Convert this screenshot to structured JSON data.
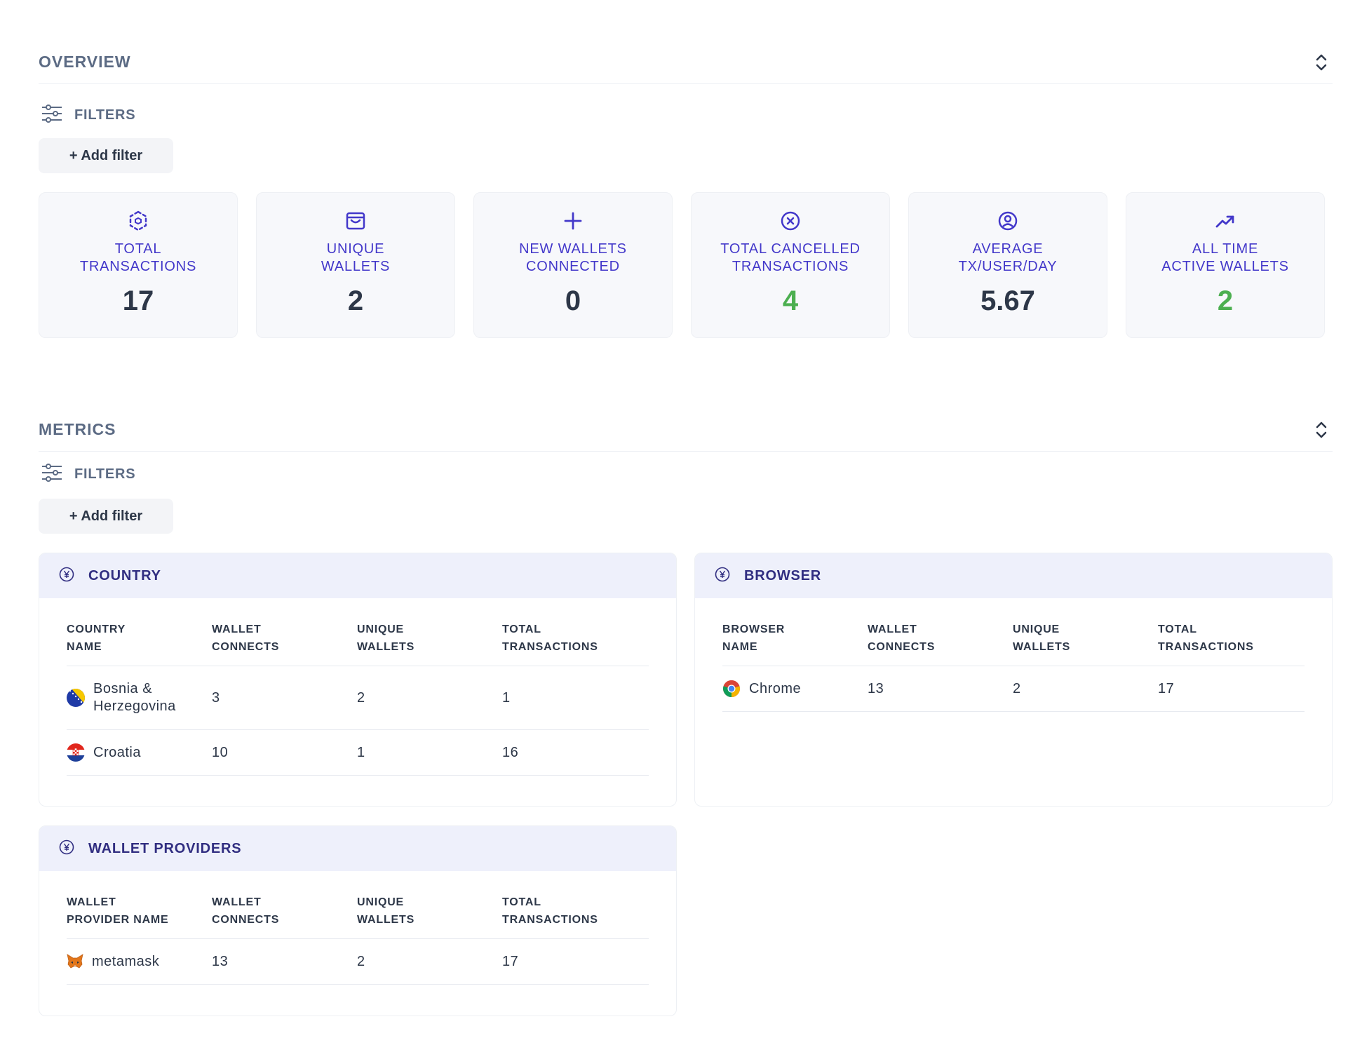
{
  "overview": {
    "title": "OVERVIEW",
    "filters_label": "FILTERS",
    "add_filter_label": "+ Add filter",
    "stats": [
      {
        "icon": "cube-icon",
        "label": "TOTAL\nTRANSACTIONS",
        "value": "17",
        "value_color": "#2d3748"
      },
      {
        "icon": "wallet-icon",
        "label": "UNIQUE\nWALLETS",
        "value": "2",
        "value_color": "#2d3748"
      },
      {
        "icon": "plus-icon",
        "label": "NEW WALLETS\nCONNECTED",
        "value": "0",
        "value_color": "#2d3748"
      },
      {
        "icon": "x-circle-icon",
        "label": "TOTAL CANCELLED\nTRANSACTIONS",
        "value": "4",
        "value_color": "#4caf50"
      },
      {
        "icon": "user-circle-icon",
        "label": "AVERAGE\nTX/USER/DAY",
        "value": "5.67",
        "value_color": "#2d3748"
      },
      {
        "icon": "trending-up-icon",
        "label": "ALL TIME\nACTIVE WALLETS",
        "value": "2",
        "value_color": "#4caf50"
      }
    ]
  },
  "metrics": {
    "title": "METRICS",
    "filters_label": "FILTERS",
    "add_filter_label": "+ Add filter",
    "country": {
      "title": "COUNTRY",
      "headers": [
        "COUNTRY\nNAME",
        "WALLET\nCONNECTS",
        "UNIQUE\nWALLETS",
        "TOTAL\nTRANSACTIONS"
      ],
      "rows": [
        {
          "name": "Bosnia &\nHerzegovina",
          "flag": "bosnia-flag-icon",
          "wallet_connects": "3",
          "unique_wallets": "2",
          "total_transactions": "1"
        },
        {
          "name": "Croatia",
          "flag": "croatia-flag-icon",
          "wallet_connects": "10",
          "unique_wallets": "1",
          "total_transactions": "16"
        }
      ]
    },
    "browser": {
      "title": "BROWSER",
      "headers": [
        "BROWSER\nNAME",
        "WALLET\nCONNECTS",
        "UNIQUE\nWALLETS",
        "TOTAL\nTRANSACTIONS"
      ],
      "rows": [
        {
          "name": "Chrome",
          "icon": "chrome-icon",
          "wallet_connects": "13",
          "unique_wallets": "2",
          "total_transactions": "17"
        }
      ]
    },
    "wallet_providers": {
      "title": "WALLET PROVIDERS",
      "headers": [
        "WALLET\nPROVIDER NAME",
        "WALLET\nCONNECTS",
        "UNIQUE\nWALLETS",
        "TOTAL\nTRANSACTIONS"
      ],
      "rows": [
        {
          "name": "metamask",
          "icon": "metamask-fox-icon",
          "wallet_connects": "13",
          "unique_wallets": "2",
          "total_transactions": "17"
        }
      ]
    }
  },
  "colors": {
    "accent": "#4338ca",
    "panel_header_bg": "#eef0fb",
    "positive": "#4caf50"
  }
}
